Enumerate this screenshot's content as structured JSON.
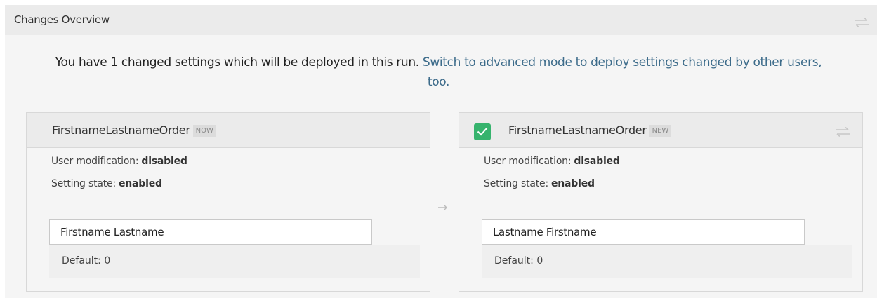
{
  "header": {
    "title": "Changes Overview",
    "toggle_icon": "swap-arrows-icon"
  },
  "intro": {
    "text": "You have 1 changed settings which will be deployed in this run.",
    "link_line1": "Switch to advanced mode to deploy settings changed by other users,",
    "link_line2": "too."
  },
  "left_card": {
    "name": "FirstnameLastnameOrder",
    "tag": "NOW",
    "user_modification_label": "User modification:",
    "user_modification_value": "disabled",
    "setting_state_label": "Setting state:",
    "setting_state_value": "enabled",
    "value": "Firstname Lastname",
    "default": "Default: 0"
  },
  "right_card": {
    "name": "FirstnameLastnameOrder",
    "tag": "NEW",
    "checkbox_checked": true,
    "user_modification_label": "User modification:",
    "user_modification_value": "disabled",
    "setting_state_label": "Setting state:",
    "setting_state_value": "enabled",
    "value": "Lastname Firstname",
    "default": "Default: 0",
    "toggle_icon": "swap-arrows-icon"
  },
  "colors": {
    "link": "#3c6b8a",
    "checkbox": "#36b36d",
    "header_bg": "#ebebeb",
    "panel_bg": "#f5f5f5"
  }
}
